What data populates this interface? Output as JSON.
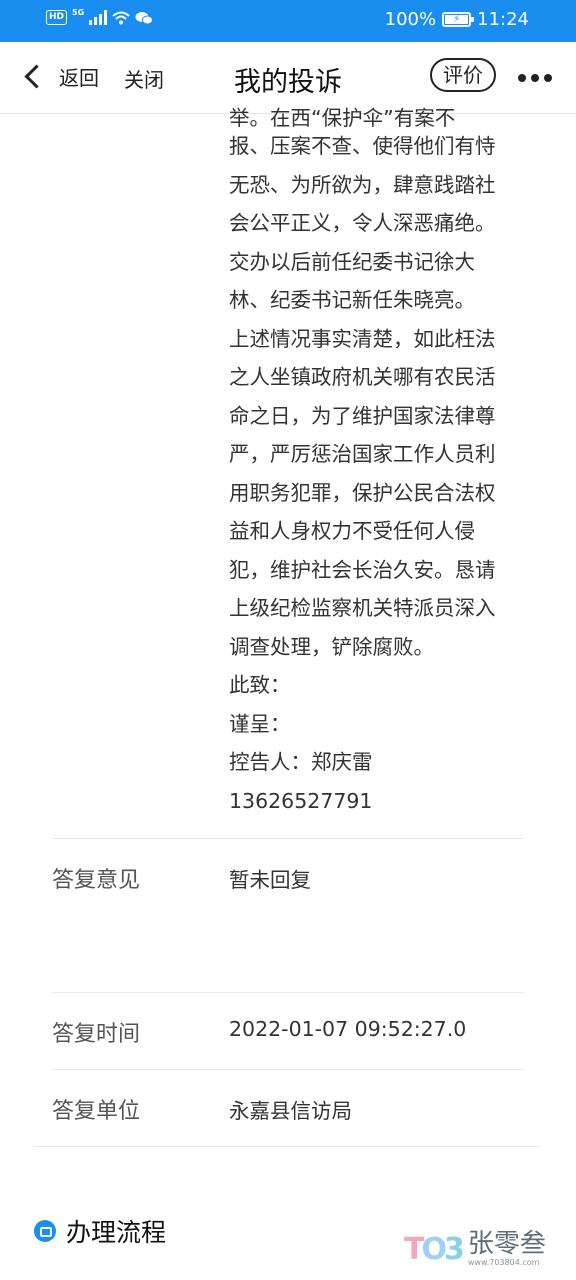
{
  "status_bar": {
    "hd": "HD",
    "network": "5G",
    "battery_percent": "100%",
    "time": "11:24"
  },
  "nav": {
    "back_label": "返回",
    "close_label": "关闭",
    "title": "我的投诉",
    "rate_label": "评价"
  },
  "complaint": {
    "cut_line": "举。在西“保护伞”有案不",
    "lines": [
      "报、压案不查、使得他们有恃",
      "无恐、为所欲为，肆意践踏社",
      "会公平正义，令人深恶痛绝。",
      "交办以后前任纪委书记徐大",
      "林、纪委书记新任朱晓亮。",
      "上述情况事实清楚，如此枉法",
      "之人坐镇政府机关哪有农民活",
      "命之日，为了维护国家法律尊",
      "严，严厉惩治国家工作人员利",
      "用职务犯罪，保护公民合法权",
      "益和人身权力不受任何人侵",
      "犯，维护社会长治久安。恳请",
      "上级纪检监察机关特派员深入",
      "调查处理，铲除腐败。",
      "此致：",
      "谨呈：",
      "控告人：郑庆雷",
      "13626527791"
    ]
  },
  "reply": {
    "opinion_label": "答复意见",
    "opinion_value": "暂未回复",
    "time_label": "答复时间",
    "time_value": "2022-01-07 09:52:27.0",
    "unit_label": "答复单位",
    "unit_value": "永嘉县信访局"
  },
  "flow": {
    "title": "办理流程"
  },
  "watermark": {
    "logo": "TO3",
    "name": "张零叁",
    "url": "www.703804.com"
  }
}
